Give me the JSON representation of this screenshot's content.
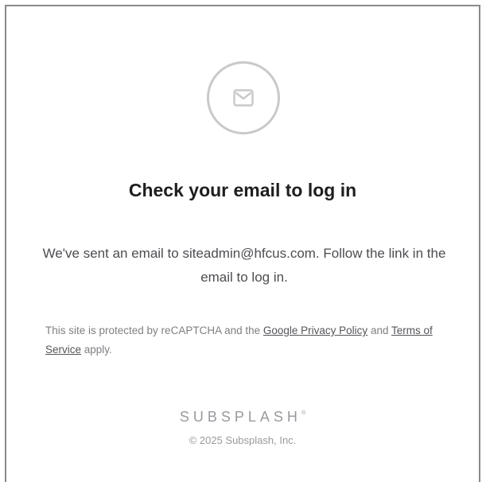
{
  "icon": {
    "name": "envelope-icon",
    "color": "#c9c9cc"
  },
  "heading": "Check your email to log in",
  "message": "We've sent an email to siteadmin@hfcus.com. Follow the link in the email to log in.",
  "legal": {
    "prefix": "This site is protected by reCAPTCHA and the ",
    "privacy_link": "Google Privacy Policy",
    "middle": " and ",
    "terms_link": "Terms of Service",
    "suffix": " apply."
  },
  "footer": {
    "brand": "SUBSPLASH",
    "brand_mark": "®",
    "copyright": "© 2025 Subsplash, Inc."
  }
}
